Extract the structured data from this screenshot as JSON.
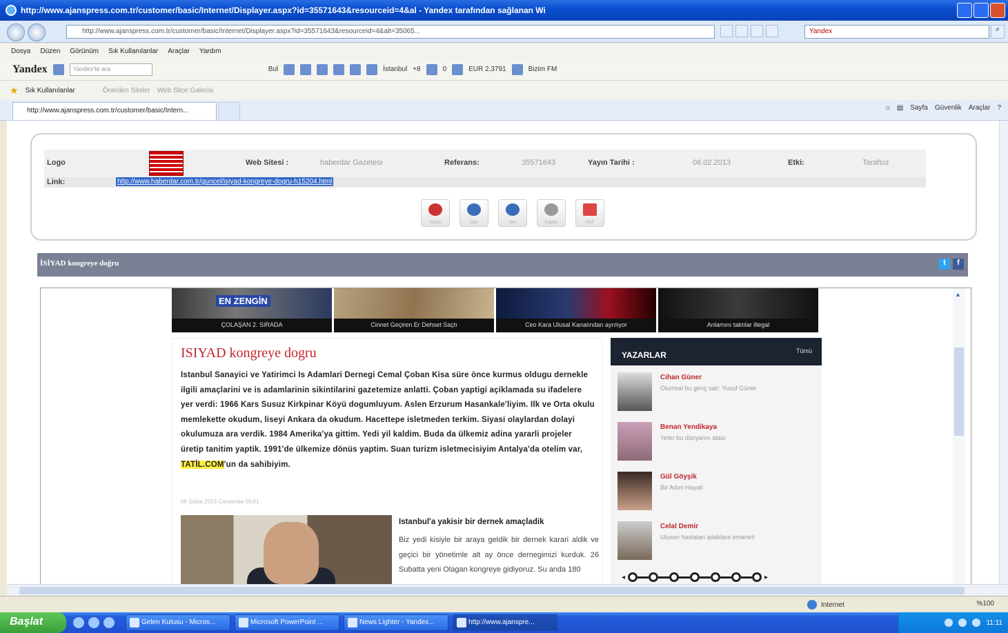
{
  "window": {
    "title": "http://www.ajanspress.com.tr/customer/basic/Internet/Displayer.aspx?id=35571643&resourceid=4&al - Yandex tarafından sağlanan Wi"
  },
  "address_bar": {
    "url": "http://www.ajanspress.com.tr/customer/basic/Internet/Displayer.aspx?id=35571643&resourceid=4&alt=35065...",
    "search_placeholder": "Yandex"
  },
  "menu": [
    "Dosya",
    "Düzen",
    "Görünüm",
    "Sık Kullanılanlar",
    "Araçlar",
    "Yardım"
  ],
  "yandex_toolbar": {
    "logo": "Yandex",
    "search_placeholder": "Yandex'te ara",
    "find_label": "Bul",
    "city": "İstanbul",
    "temp": "+8",
    "mail": "0",
    "currency": "EUR 2,3791",
    "radio": "Bizim FM"
  },
  "favorites": {
    "label": "Sık Kullanılanlar",
    "item1": "Önerilen Siteler",
    "item2": "Web Slice Galerisi"
  },
  "tab": {
    "label": "http://www.ajanspress.com.tr/customer/basic/Intern..."
  },
  "command_bar": [
    "Sayfa",
    "Güvenlik",
    "Araçlar"
  ],
  "info": {
    "logo_label": "Logo",
    "website_label": "Web Sitesi :",
    "website_value": "haberdar Gazetesi",
    "ref_label": "Referans:",
    "ref_value": "35571643",
    "date_label": "Yayın Tarihi :",
    "date_value": "06.02.2013",
    "etki_label": "Etki:",
    "etki_value": "Tarafsız",
    "link_label": "Link:",
    "link_value": "http://www.haberdar.com.tr/guncel/isiyad-kongreye-dogru-h15204.html",
    "actions": [
      "Yazdır",
      "Geri",
      "İleri",
      "Kaydet",
      "PDF"
    ]
  },
  "article_header": "İSİYAD kongreye doğru",
  "strip": [
    {
      "caption": "ÇOLAŞAN 2. SIRADA",
      "overlay": "EN ZENGİN"
    },
    {
      "caption": "Cinnet Geçiren Er Dehset Saçtı"
    },
    {
      "caption": "Ceo Kara Ulusal Kanalından ayrılıyor"
    },
    {
      "caption": "Anlamını taktılar illegal"
    }
  ],
  "article": {
    "title": "ISIYAD kongreye dogru",
    "body_before": "Istanbul Sanayici ve Yatirimci Is Adamlari Dernegi Cemal Çoban Kisa süre önce kurmus oldugu dernekle ilgili amaçlarini ve is adamlarinin sikintilarini gazetemize anlatti. Çoban yaptigi açiklamada su ifadelere yer verdi: 1966 Kars Susuz Kirkpinar Köyü dogumluyum. Aslen Erzurum Hasankale'liyim. Ilk ve Orta okulu memlekette okudum, liseyi Ankara da okudum. Hacettepe isletmeden terkim. Siyasi olaylardan dolayi okulumuza ara verdik. 1984 Amerika'ya gittim. Yedi yil kaldim. Buda da ülkemiz adina yararli projeler üretip tanitim yaptik. 1991'de ülkemize dönüs yaptim. Suan turizm isletmecisiyim Antalya'da otelim var, ",
    "body_highlight": "TATİL.COM",
    "body_after": "'un da sahibiyim.",
    "date": "06 Şubat 2013 Çarşamba 09:01",
    "subheading": "Istanbul'a yakisir bir dernek amaçladik",
    "subtext": "Biz yedi kisiyle bir araya geldik bir dernek karari aldik ve geçici bir yönetimle alt ay önce dernegimizi kurduk. 26 Subatta yeni Olagan kongreye gidiyoruz. Su anda 180"
  },
  "yazarlar": {
    "title": "YAZARLAR",
    "all": "Tümü",
    "items": [
      {
        "name": "Cihan Güner",
        "desc": "Olumsal bu genç sair: Yusuf Güner"
      },
      {
        "name": "Benan Yendikaya",
        "desc": "Yeter bu dünyanın atası"
      },
      {
        "name": "Gül Göyşik",
        "desc": "Bir Adım Hayati"
      },
      {
        "name": "Celal Demir",
        "desc": "Ulusen hastaları adaklara emanet!"
      }
    ]
  },
  "status": {
    "zone": "Internet",
    "zoom": "%100"
  },
  "taskbar": {
    "start": "Başlat",
    "items": [
      "Gelen Kutusu - Micros...",
      "Microsoft PowerPoint ...",
      "News Lighter - Yandex...",
      "http://www.ajanspre..."
    ],
    "clock": "11:11"
  }
}
